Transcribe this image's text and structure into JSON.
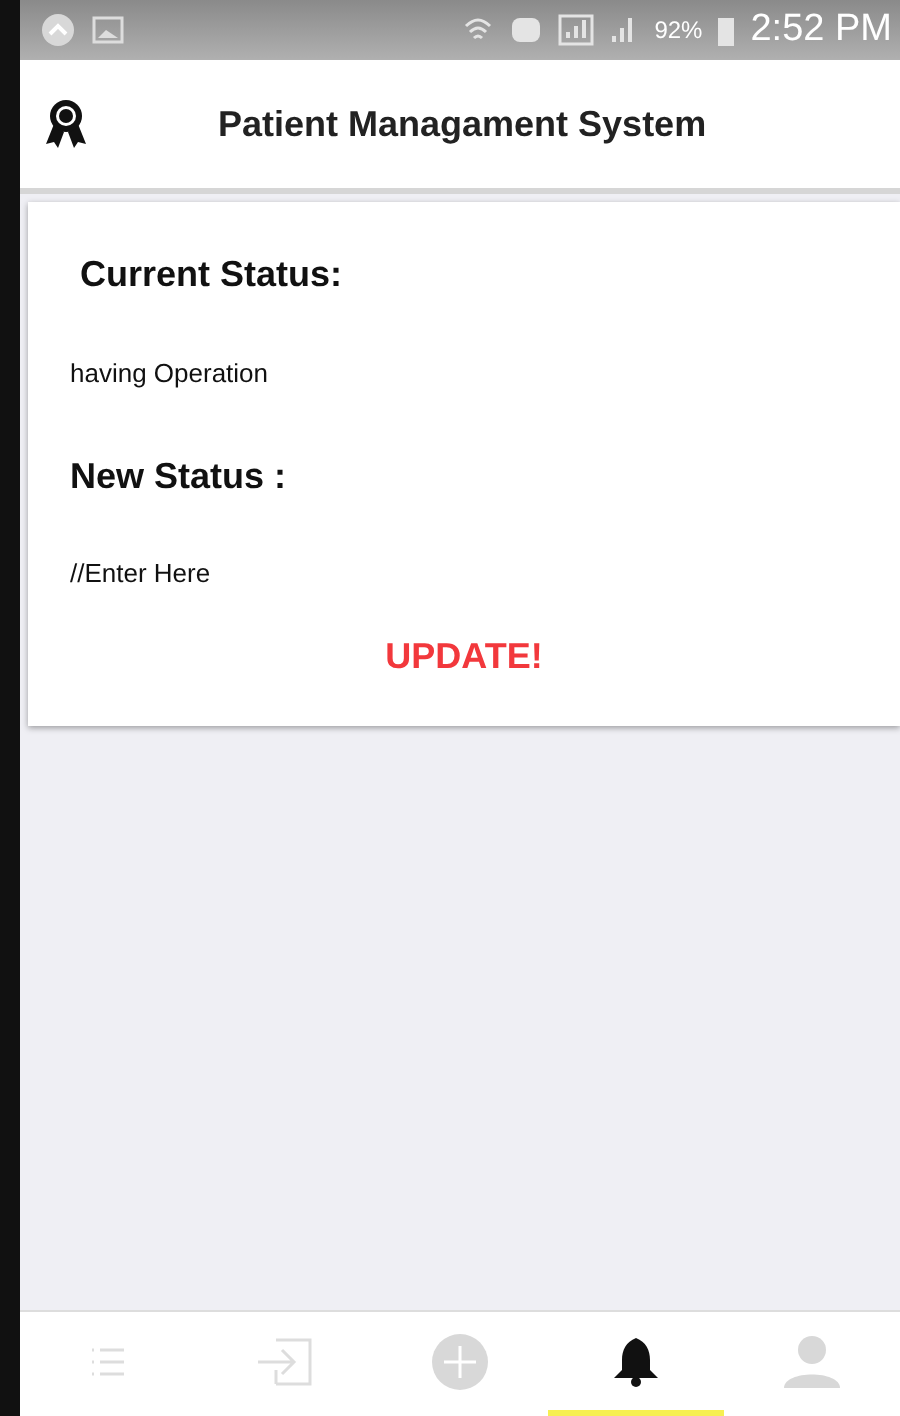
{
  "status_bar": {
    "battery": "92%",
    "time": "2:52 PM"
  },
  "header": {
    "title": "Patient Managament System"
  },
  "card": {
    "current_label": "Current Status:",
    "current_value": "having Operation",
    "new_label": "New Status :",
    "new_field": {
      "placeholder": "//Enter Here"
    },
    "button": "UPDATE!"
  },
  "tabs": [
    {
      "kind": "list",
      "selected": false
    },
    {
      "kind": "login",
      "selected": false
    },
    {
      "kind": "add",
      "selected": false
    },
    {
      "kind": "bell",
      "selected": true
    },
    {
      "kind": "person",
      "selected": false
    }
  ]
}
